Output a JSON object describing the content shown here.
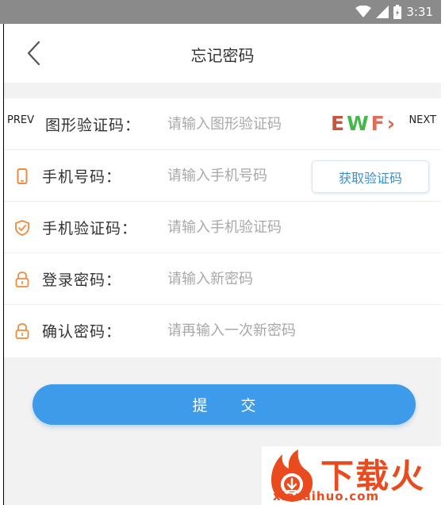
{
  "status_bar": {
    "time": "3:31",
    "wifi_icon": "wifi-icon",
    "signal_icon": "signal-icon",
    "battery_icon": "battery-icon"
  },
  "header": {
    "title": "忘记密码",
    "back_icon": "chevron-left-icon"
  },
  "captcha_nav": {
    "prev": "PREV",
    "next": "NEXT"
  },
  "captcha": {
    "text": [
      "E",
      "W",
      "F",
      "›"
    ],
    "colors": [
      "#c8553d",
      "#44b84a",
      "#e26c5a",
      "#d86a4a"
    ]
  },
  "form": {
    "rows": [
      {
        "label": "图形验证码：",
        "placeholder": "请输入图形验证码",
        "icon": ""
      },
      {
        "label": "手机号码：",
        "placeholder": "请输入手机号码",
        "icon": "phone-icon"
      },
      {
        "label": "手机验证码：",
        "placeholder": "请输入手机验证码",
        "icon": "shield-icon"
      },
      {
        "label": "登录密码：",
        "placeholder": "请输入新密码",
        "icon": "lock-icon"
      },
      {
        "label": "确认密码：",
        "placeholder": "请再输入一次新密码",
        "icon": "lock-icon"
      }
    ],
    "get_code_button": "获取验证码"
  },
  "submit_button": "提 交",
  "watermark": {
    "name": "下载火",
    "url": "xiazaihuo.com"
  },
  "colors": {
    "accent": "#3d9be9",
    "icon": "#f08a3c",
    "background": "#f2f2f2",
    "watermark": "#e94a1e"
  }
}
